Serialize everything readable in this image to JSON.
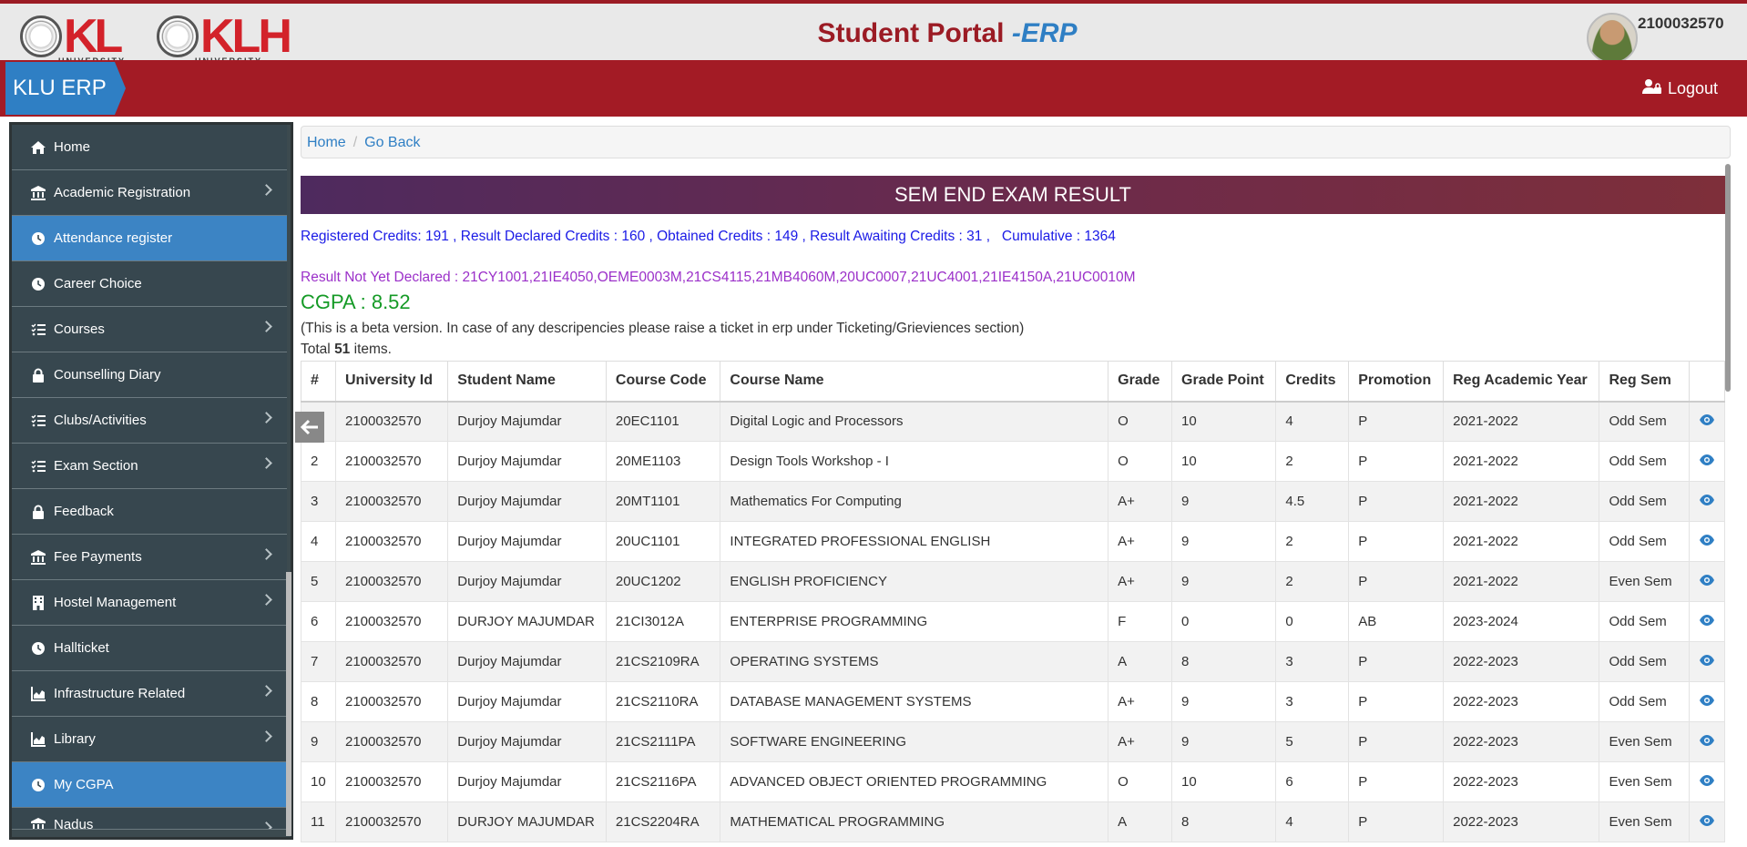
{
  "header": {
    "title_main": "Student Portal ",
    "title_erp": "-ERP",
    "user_id": "2100032570",
    "logo1_text": "KL",
    "logo1_sub": "UNIVERSITY",
    "logo2_text": "KLH",
    "logo2_sub": "UNIVERSITY"
  },
  "navbar": {
    "brand": "KLU ERP",
    "logout_label": "Logout"
  },
  "sidebar": {
    "items": [
      {
        "label": "Home",
        "icon": "home-icon",
        "has_chevron": false,
        "active": false
      },
      {
        "label": "Academic Registration",
        "icon": "university-icon",
        "has_chevron": true,
        "active": false
      },
      {
        "label": "Attendance register",
        "icon": "clock-icon",
        "has_chevron": false,
        "active": true
      },
      {
        "label": "Career Choice",
        "icon": "clock-icon",
        "has_chevron": false,
        "active": false
      },
      {
        "label": "Courses",
        "icon": "list-check-icon",
        "has_chevron": true,
        "active": false
      },
      {
        "label": "Counselling Diary",
        "icon": "lock-icon",
        "has_chevron": false,
        "active": false
      },
      {
        "label": "Clubs/Activities",
        "icon": "list-check-icon",
        "has_chevron": true,
        "active": false
      },
      {
        "label": "Exam Section",
        "icon": "list-check-icon",
        "has_chevron": true,
        "active": false
      },
      {
        "label": "Feedback",
        "icon": "lock-icon",
        "has_chevron": false,
        "active": false
      },
      {
        "label": "Fee Payments",
        "icon": "university-icon",
        "has_chevron": true,
        "active": false
      },
      {
        "label": "Hostel Management",
        "icon": "building-icon",
        "has_chevron": true,
        "active": false
      },
      {
        "label": "Hallticket",
        "icon": "clock-icon",
        "has_chevron": false,
        "active": false
      },
      {
        "label": "Infrastructure Related",
        "icon": "chart-area-icon",
        "has_chevron": true,
        "active": false
      },
      {
        "label": "Library",
        "icon": "chart-area-icon",
        "has_chevron": true,
        "active": false
      },
      {
        "label": "My CGPA",
        "icon": "clock-icon",
        "has_chevron": false,
        "active": true
      },
      {
        "label": "Nadus",
        "icon": "university-icon",
        "has_chevron": true,
        "active": false
      }
    ]
  },
  "breadcrumb": {
    "home": "Home",
    "back": "Go Back"
  },
  "result": {
    "banner": "SEM END EXAM RESULT",
    "credits_line": "Registered Credits: 191 , Result Declared Credits : 160 , Obtained Credits : 149 , Result Awaiting Credits : 31 ,   Cumulative : 1364",
    "not_declared": "Result Not Yet Declared : 21CY1001,21IE4050,OEME0003M,21CS4115,21MB4060M,20UC0007,21UC4001,21IE4150A,21UC0010M",
    "cgpa": "CGPA : 8.52",
    "beta_note": "(This is a beta version. In case of any descripencies please raise a ticket in erp under Ticketing/Grieviences section)",
    "total_prefix": "Total ",
    "total_count": "51",
    "total_suffix": " items."
  },
  "table": {
    "headers": [
      "#",
      "University Id",
      "Student Name",
      "Course Code",
      "Course Name",
      "Grade",
      "Grade Point",
      "Credits",
      "Promotion",
      "Reg Academic Year",
      "Reg Sem",
      ""
    ],
    "rows": [
      [
        "1",
        "2100032570",
        "Durjoy Majumdar",
        "20EC1101",
        "Digital Logic and Processors",
        "O",
        "10",
        "4",
        "P",
        "2021-2022",
        "Odd Sem"
      ],
      [
        "2",
        "2100032570",
        "Durjoy Majumdar",
        "20ME1103",
        "Design Tools Workshop - I",
        "O",
        "10",
        "2",
        "P",
        "2021-2022",
        "Odd Sem"
      ],
      [
        "3",
        "2100032570",
        "Durjoy Majumdar",
        "20MT1101",
        "Mathematics For Computing",
        "A+",
        "9",
        "4.5",
        "P",
        "2021-2022",
        "Odd Sem"
      ],
      [
        "4",
        "2100032570",
        "Durjoy Majumdar",
        "20UC1101",
        "INTEGRATED PROFESSIONAL ENGLISH",
        "A+",
        "9",
        "2",
        "P",
        "2021-2022",
        "Odd Sem"
      ],
      [
        "5",
        "2100032570",
        "Durjoy Majumdar",
        "20UC1202",
        "ENGLISH PROFICIENCY",
        "A+",
        "9",
        "2",
        "P",
        "2021-2022",
        "Even Sem"
      ],
      [
        "6",
        "2100032570",
        "DURJOY MAJUMDAR",
        "21CI3012A",
        "ENTERPRISE PROGRAMMING",
        "F",
        "0",
        "0",
        "AB",
        "2023-2024",
        "Odd Sem"
      ],
      [
        "7",
        "2100032570",
        "Durjoy Majumdar",
        "21CS2109RA",
        "OPERATING SYSTEMS",
        "A",
        "8",
        "3",
        "P",
        "2022-2023",
        "Odd Sem"
      ],
      [
        "8",
        "2100032570",
        "Durjoy Majumdar",
        "21CS2110RA",
        "DATABASE MANAGEMENT SYSTEMS",
        "A+",
        "9",
        "3",
        "P",
        "2022-2023",
        "Odd Sem"
      ],
      [
        "9",
        "2100032570",
        "Durjoy Majumdar",
        "21CS2111PA",
        "SOFTWARE ENGINEERING",
        "A+",
        "9",
        "5",
        "P",
        "2022-2023",
        "Even Sem"
      ],
      [
        "10",
        "2100032570",
        "Durjoy Majumdar",
        "21CS2116PA",
        "ADVANCED OBJECT ORIENTED PROGRAMMING",
        "O",
        "10",
        "6",
        "P",
        "2022-2023",
        "Even Sem"
      ],
      [
        "11",
        "2100032570",
        "DURJOY MAJUMDAR",
        "21CS2204RA",
        "MATHEMATICAL PROGRAMMING",
        "A",
        "8",
        "4",
        "P",
        "2022-2023",
        "Even Sem"
      ]
    ]
  },
  "colors": {
    "brand_red": "#a31b25",
    "brand_blue": "#2f7fc4",
    "sidebar_bg": "#37474f",
    "cgpa_green": "#159a26",
    "credits_blue": "#1a1ae6",
    "pending_purple": "#9b30c9"
  }
}
